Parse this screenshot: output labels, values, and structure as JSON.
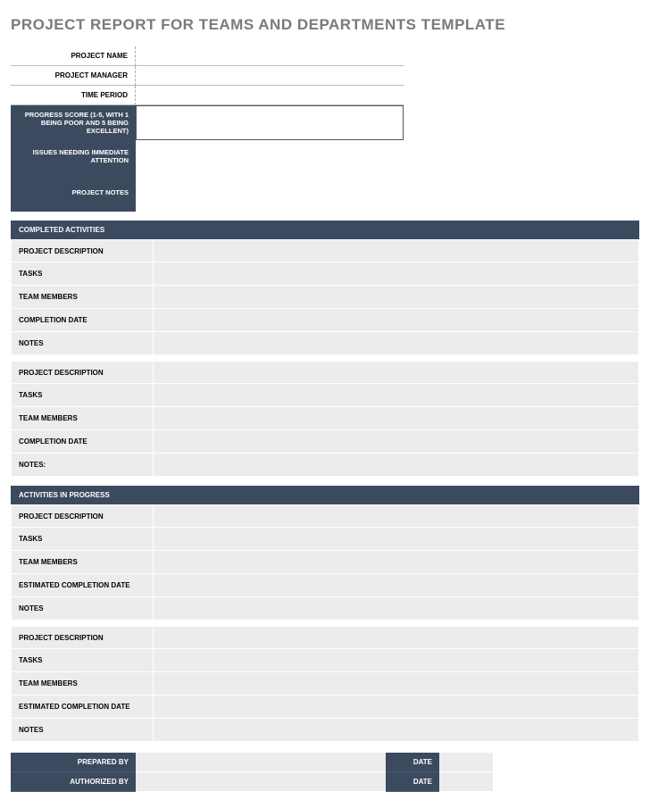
{
  "title": "PROJECT REPORT FOR TEAMS AND DEPARTMENTS TEMPLATE",
  "header": {
    "project_name": {
      "label": "PROJECT NAME",
      "value": ""
    },
    "project_manager": {
      "label": "PROJECT MANAGER",
      "value": ""
    },
    "time_period": {
      "label": "TIME PERIOD",
      "value": ""
    },
    "progress_score": {
      "label": "PROGRESS SCORE (1-5, WITH 1 BEING POOR AND 5 BEING EXCELLENT)",
      "value": ""
    },
    "issues": {
      "label": "ISSUES NEEDING IMMEDIATE ATTENTION",
      "value": ""
    },
    "project_notes": {
      "label": "PROJECT NOTES",
      "value": ""
    }
  },
  "sections": {
    "completed": {
      "heading": "COMPLETED ACTIVITIES",
      "blocks": [
        {
          "project_description": "PROJECT DESCRIPTION",
          "tasks": "TASKS",
          "team_members": "TEAM MEMBERS",
          "completion_date": "COMPLETION DATE",
          "notes": "NOTES"
        },
        {
          "project_description": "PROJECT DESCRIPTION",
          "tasks": "TASKS",
          "team_members": "TEAM MEMBERS",
          "completion_date": "COMPLETION DATE",
          "notes": "NOTES:"
        }
      ]
    },
    "in_progress": {
      "heading": "ACTIVITIES IN PROGRESS",
      "blocks": [
        {
          "project_description": "PROJECT DESCRIPTION",
          "tasks": "TASKS",
          "team_members": "TEAM MEMBERS",
          "est_completion": "ESTIMATED COMPLETION DATE",
          "notes": "NOTES"
        },
        {
          "project_description": "PROJECT DESCRIPTION",
          "tasks": "TASKS",
          "team_members": "TEAM MEMBERS",
          "est_completion": "ESTIMATED COMPLETION DATE",
          "notes": "NOTES"
        }
      ]
    }
  },
  "footer": {
    "prepared_by": {
      "label": "PREPARED BY",
      "value": ""
    },
    "authorized_by": {
      "label": "AUTHORIZED BY",
      "value": ""
    },
    "date_label": "DATE",
    "date1": "",
    "date2": ""
  }
}
